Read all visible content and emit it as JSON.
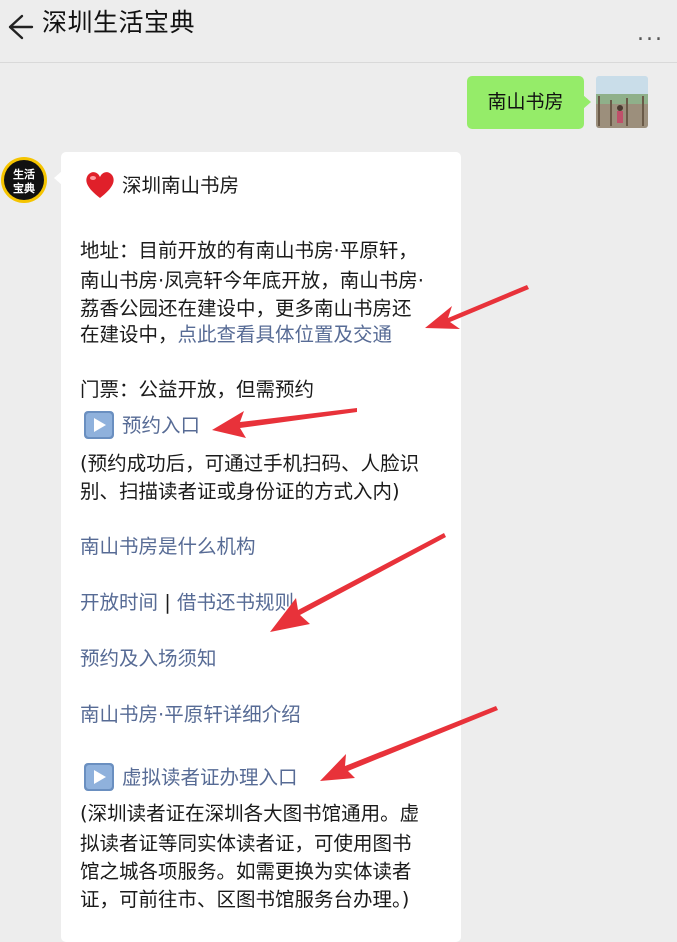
{
  "header": {
    "title": "深圳生活宝典",
    "back_icon": "arrow-left-icon",
    "more_icon": "more-dots-icon",
    "more_label": "..."
  },
  "user_message": {
    "text": "南山书房"
  },
  "bot_avatar": {
    "text_top": "生活",
    "text_bottom": "宝典"
  },
  "reply": {
    "title": "深圳南山书房",
    "address_lines": [
      "地址：目前开放的有南山书房·平原轩，",
      "南山书房·凤亮轩今年底开放，南山书房·",
      "荔香公园还在建设中，更多南山书房还"
    ],
    "address_last_prefix": "在建设中，",
    "address_link": "点此查看具体位置及交通",
    "ticket": "门票：公益开放，但需预约",
    "booking_link": "预约入口",
    "booking_note_lines": [
      "(预约成功后，可通过手机扫码、人脸识",
      "别、扫描读者证或身份证的方式入内)"
    ],
    "links": {
      "what_is": "南山书房是什么机构",
      "opening_hours": "开放时间",
      "separator": " | ",
      "borrow_rules": "借书还书规则",
      "entry_notice": "预约及入场须知",
      "pingyuan_intro": "南山书房·平原轩详细介绍"
    },
    "virtual_card_link": "虚拟读者证办理入口",
    "virtual_note_lines": [
      "(深圳读者证在深圳各大图书馆通用。虚",
      "拟读者证等同实体读者证，可使用图书",
      "馆之城各项服务。如需更换为实体读者",
      "证，可前往市、区图书馆服务台办理。)"
    ]
  },
  "colors": {
    "background": "#ededed",
    "bubble_green": "#95ec69",
    "link": "#576b95",
    "annotation_red": "#e8323a"
  }
}
